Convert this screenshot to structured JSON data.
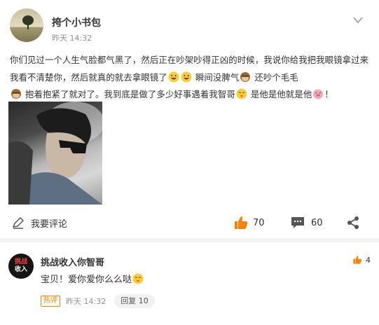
{
  "post": {
    "author": "挎个小书包",
    "time": "昨天 14:32",
    "text_parts": [
      "你们见过一个人生气脸都气黑了，然后正在吵架吵得正凶的时候，我说你给我把我眼镜拿过来我看不清楚你，然后就真的就去拿眼镜了",
      "瞬间没脾气",
      "还吵个毛毛",
      "抱着抱紧了就对了。我到底是做了多少好事遇着我智哥",
      "是他是他就是他",
      "！"
    ],
    "emojis": [
      "grin-emoji",
      "grin-emoji",
      "monkey-emoji",
      "monkey-emoji",
      "kiss-emoji",
      "pig-emoji"
    ]
  },
  "actions": {
    "comment_placeholder": "我要评论",
    "likes": "70",
    "comments": "60"
  },
  "comment": {
    "avatar_line1": "挑战",
    "avatar_line2": "收入",
    "name": "挑战收入你智哥",
    "likes": "4",
    "text": "宝贝！爱你爱你么么哒",
    "badge": "热评",
    "time": "昨天 14:32",
    "reply": "回复 10"
  },
  "colors": {
    "accent_orange": "#ff8200",
    "text": "#333333",
    "meta_gray": "#939393"
  }
}
